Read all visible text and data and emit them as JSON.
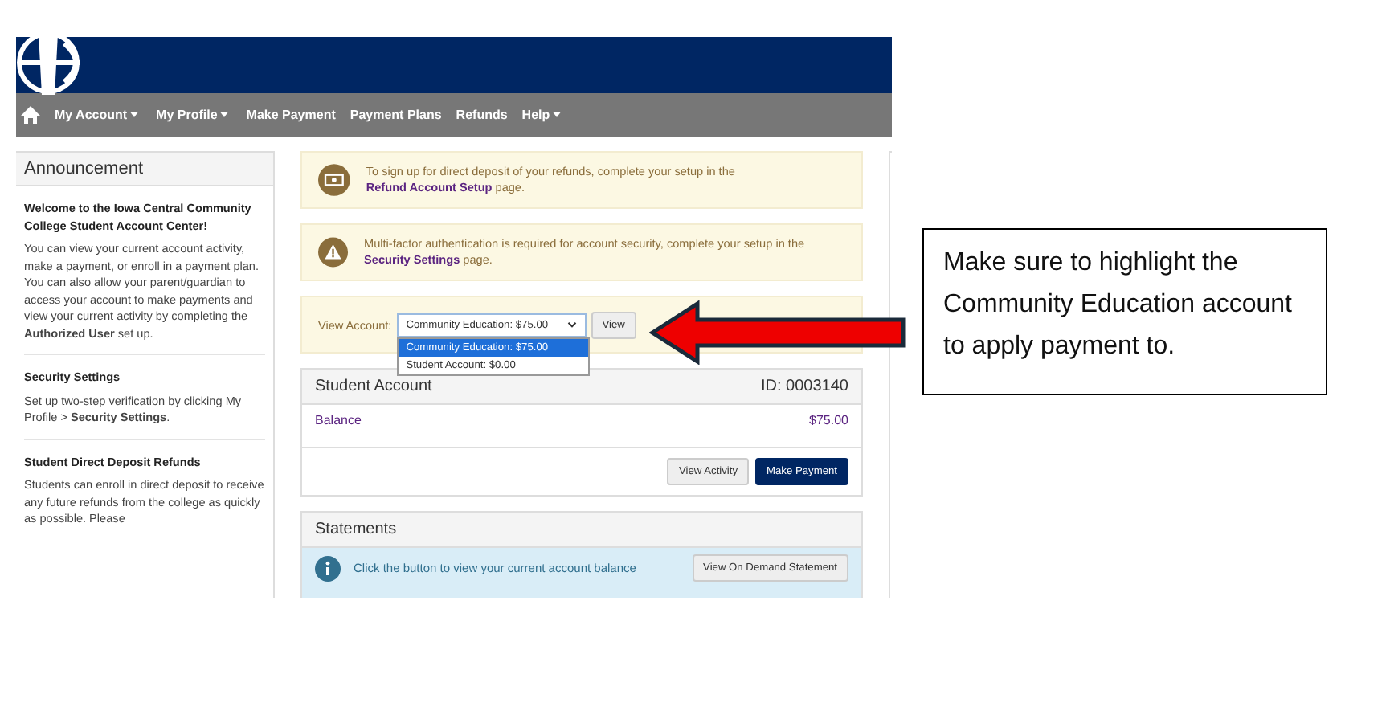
{
  "nav": {
    "items": [
      {
        "label": "My Account",
        "dropdown": true
      },
      {
        "label": "My Profile",
        "dropdown": true
      },
      {
        "label": "Make Payment",
        "dropdown": false
      },
      {
        "label": "Payment Plans",
        "dropdown": false
      },
      {
        "label": "Refunds",
        "dropdown": false
      },
      {
        "label": "Help",
        "dropdown": true
      }
    ]
  },
  "announcement": {
    "title": "Announcement",
    "sections": [
      {
        "heading": "Welcome to the Iowa Central Community College Student Account Center!",
        "body": "You can view your current account activity, make a payment, or enroll in a payment plan.  You can also allow your parent/guardian to access your account to make payments and view your current activity by completing the **Authorized User** set up."
      },
      {
        "heading": "Security Settings",
        "body": "Set up two-step verification by clicking My Profile > **Security Settings**."
      },
      {
        "heading": "Student Direct Deposit Refunds",
        "body": "Students can enroll in direct deposit to receive any future refunds from the college as quickly as possible.  Please"
      }
    ]
  },
  "alerts": [
    {
      "kind": "money",
      "before": "To sign up for direct deposit of your refunds, complete your setup in the ",
      "link": "Refund Account Setup",
      "after": " page."
    },
    {
      "kind": "warning",
      "before": "Multi-factor authentication is required for account security, complete your setup in the ",
      "link": "Security Settings",
      "after": " page."
    }
  ],
  "view_account": {
    "label": "View Account:",
    "value": "Community Education: $75.00",
    "button": "View",
    "options": [
      {
        "label": "Community Education: $75.00",
        "selected": true
      },
      {
        "label": "Student Account: $0.00",
        "selected": false
      }
    ]
  },
  "student_account": {
    "title": "Student Account",
    "id": "ID: 0003140",
    "balance_label": "Balance",
    "balance": "$75.00",
    "buttons": [
      {
        "label": "View Activity",
        "kind": "default"
      },
      {
        "label": "Make Payment",
        "kind": "primary"
      }
    ]
  },
  "statements": {
    "title": "Statements",
    "text": "Click the button to view your current account balance",
    "button": "View On Demand Statement"
  },
  "callout": {
    "text": "Make sure to highlight the Community Education account to apply payment to."
  }
}
